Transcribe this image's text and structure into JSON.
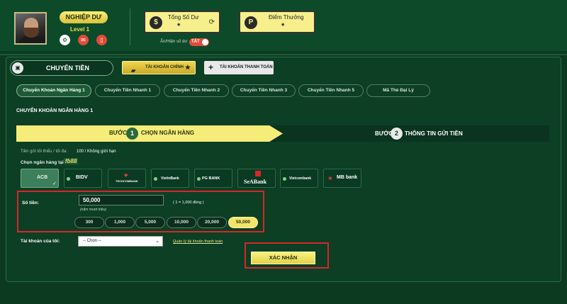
{
  "header": {
    "rank_label": "NGHIỆP DƯ",
    "level_label": "Level 1",
    "icons": [
      "user-settings-icon",
      "message-icon",
      "mobile-icon"
    ],
    "balance": {
      "title": "Tổng Số Dư",
      "value": "*",
      "icon": "coins-icon"
    },
    "points": {
      "title": "Điểm Thưởng",
      "value": "*",
      "icon": "points-icon"
    },
    "hide_balance_label": "Ẩn/Hiện số dư",
    "toggle_label": "TẮT"
  },
  "transfer": {
    "main_tab_label": "CHUYỂN TIỀN",
    "main_account_label": "TÀI KHOẢN CHÍNH",
    "main_account_star": "★",
    "pay_account_label": "TÀI KHOẢN THANH TOÁN",
    "pay_account_plus": "+"
  },
  "subtabs": [
    {
      "label": "Chuyển Khoản Ngân Hàng 1"
    },
    {
      "label": "Chuyển Tiền Nhanh 1"
    },
    {
      "label": "Chuyển Tiền Nhanh 2"
    },
    {
      "label": "Chuyển Tiền Nhanh 3"
    },
    {
      "label": "Chuyển Tiền Nhanh 5"
    },
    {
      "label": "Mã Thẻ Đại Lý"
    }
  ],
  "section_title": "CHUYỂN KHOẢN NGÂN HÀNG 1",
  "steps": {
    "step1": {
      "prefix": "BƯỚC",
      "number": "1",
      "name": "CHỌN NGÂN HÀNG"
    },
    "step2": {
      "prefix": "BƯỚC",
      "number": "2",
      "name": "THÔNG TIN GỬI TIỀN"
    }
  },
  "limits": {
    "label": "Tiền gửi tối thiểu / tối đa:",
    "value": "100 / Không giới hạn"
  },
  "bank_select": {
    "label": "Chọn ngân hàng tại",
    "brand": "fb88"
  },
  "banks": [
    {
      "name": "ACB"
    },
    {
      "name": "BIDV"
    },
    {
      "name": "TECHCOMBANK"
    },
    {
      "name": "VietinBank"
    },
    {
      "name": "PG BANK"
    },
    {
      "name": "SeABank"
    },
    {
      "name": "Vietcombank"
    },
    {
      "name": "MB bank"
    }
  ],
  "amount": {
    "label": "Số tiền:",
    "value": "50,000",
    "hint": "(năm mươi triệu)",
    "range": "( 1 = 1,000 đồng )",
    "chips": [
      "300",
      "1,000",
      "5,000",
      "10,000",
      "20,000",
      "50,000"
    ],
    "selected_chip": "50,000"
  },
  "account": {
    "label": "Tài khoản của tôi:",
    "placeholder": "-- Chọn --",
    "manage_link": "Quản lý tài khoản thanh toán"
  },
  "confirm_label": "XÁC NHẬN"
}
